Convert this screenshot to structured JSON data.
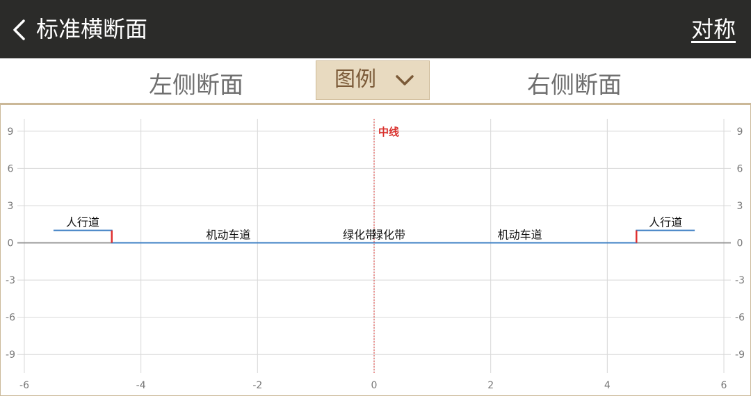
{
  "header": {
    "title": "标准横断面",
    "symmetric_button": "对称"
  },
  "tabs": {
    "left": "左侧断面",
    "legend": "图例",
    "right": "右侧断面"
  },
  "colors": {
    "header_bg": "#2b2b29",
    "accent": "#cbb898",
    "legend_bg": "#e8dac0",
    "profile_line": "#3d7fc4",
    "step_line": "#e03030",
    "centerline": "#d9302c",
    "grid": "#d8d8d8",
    "zero_line": "#999999"
  },
  "icons": {
    "back": "chevron-left-icon",
    "legend_toggle": "chevron-down-icon"
  },
  "chart_data": {
    "type": "line",
    "xlim": [
      -6,
      6
    ],
    "ylim": [
      -10.5,
      10
    ],
    "x_ticks": [
      -6,
      -4,
      -2,
      0,
      2,
      4,
      6
    ],
    "y_ticks": [
      9,
      6,
      3,
      0,
      -3,
      -6,
      -9
    ],
    "grid": true,
    "centerline": {
      "x": 0,
      "label": "中线"
    },
    "series": [
      {
        "values": [
          [
            -5.5,
            1
          ],
          [
            -4.5,
            1
          ],
          [
            -4.5,
            0
          ],
          [
            0,
            0
          ],
          [
            4.5,
            0
          ],
          [
            4.5,
            1
          ],
          [
            5.5,
            1
          ]
        ]
      }
    ],
    "step_edges": [
      -4.5,
      4.5
    ],
    "segments": [
      {
        "label": "人行道",
        "x": -5.0,
        "y": 1
      },
      {
        "label": "机动车道",
        "x": -2.5,
        "y": 0
      },
      {
        "label": "绿化带",
        "x": -0.25,
        "y": 0
      },
      {
        "label": "绿化带",
        "x": 0.25,
        "y": 0
      },
      {
        "label": "机动车道",
        "x": 2.5,
        "y": 0
      },
      {
        "label": "人行道",
        "x": 5.0,
        "y": 1
      }
    ]
  }
}
